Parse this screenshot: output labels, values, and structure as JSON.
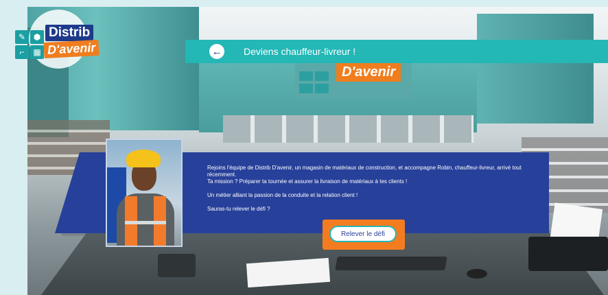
{
  "logo": {
    "line1": "Distrib",
    "line2": "D'avenir",
    "tile_icons": [
      "pin-icon",
      "brush-icon",
      "trowel-icon",
      "brick-icon"
    ],
    "tile_glyphs": [
      "✎",
      "⬢",
      "⌐",
      "▦"
    ]
  },
  "header": {
    "back_glyph": "←",
    "title": "Deviens chauffeur-livreur !"
  },
  "background": {
    "sign_text": "D'avenir"
  },
  "mission": {
    "paragraph1": "Rejoins l'équipe de Distrib D'avenir, un magasin de matériaux de construction, et accompagne Robin, chauffeur-livreur, arrivé tout récemment.",
    "paragraph2": "Ta mission ? Préparer ta tournée et assurer la livraison de matériaux à tes clients !",
    "paragraph3": "Un métier alliant la passion de la conduite et la relation client !",
    "paragraph4": "Sauras-tu relever le défi ?",
    "cta_label": "Relever le défi"
  },
  "colors": {
    "teal": "#23b7b6",
    "navy": "#27409a",
    "orange": "#f47c20"
  }
}
